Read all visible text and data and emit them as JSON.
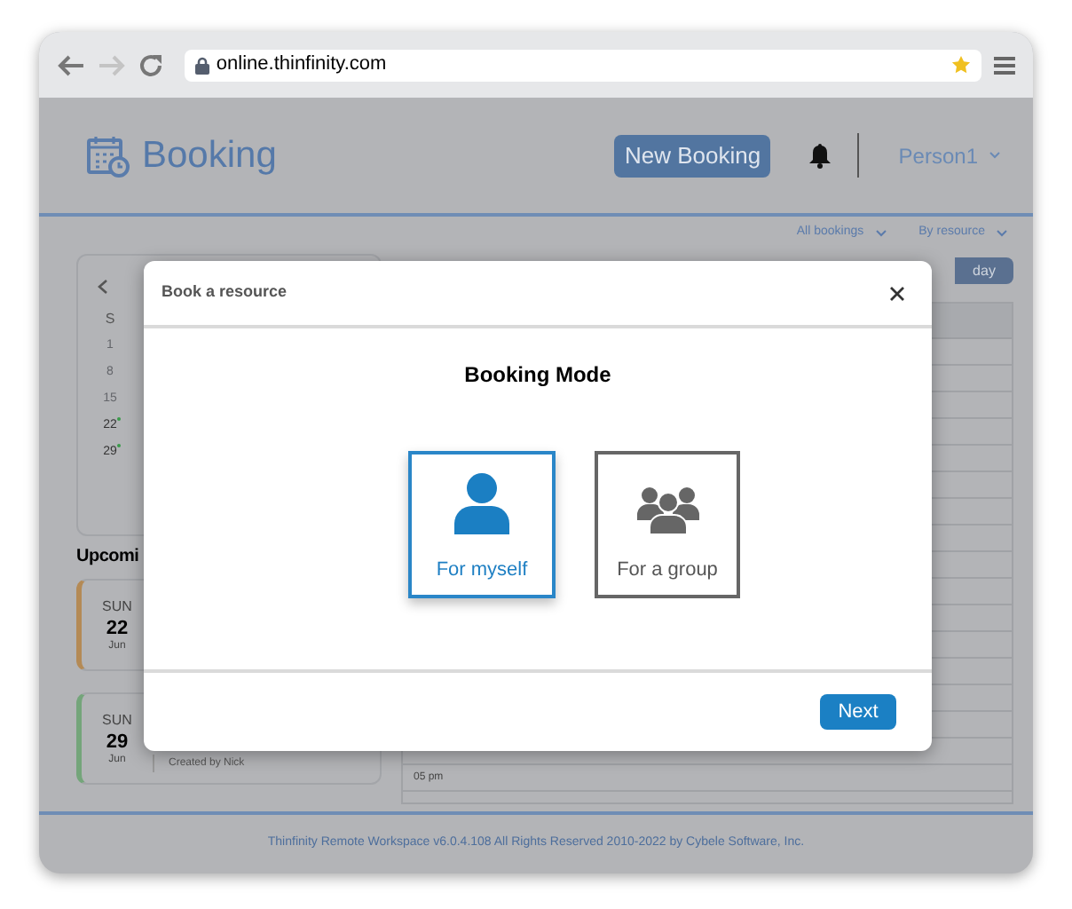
{
  "browser": {
    "url": "online.thinfinity.com"
  },
  "header": {
    "title": "Booking",
    "new_booking": "New Booking",
    "user": "Person1"
  },
  "filters": [
    {
      "label": "All bookings"
    },
    {
      "label": "By resource"
    }
  ],
  "mini_calendar": {
    "weekday": "S",
    "days": [
      {
        "label": "1",
        "has_booking": false
      },
      {
        "label": "8",
        "has_booking": false
      },
      {
        "label": "15",
        "has_booking": false
      },
      {
        "label": "22",
        "has_booking": true
      },
      {
        "label": "29",
        "has_booking": true
      }
    ]
  },
  "upcoming": {
    "heading": "Upcomi",
    "events": [
      {
        "weekday": "SUN",
        "day": "22",
        "month": "Jun",
        "color": "#b48a55"
      },
      {
        "weekday": "SUN",
        "day": "29",
        "month": "Jun",
        "color": "#74a57a",
        "note": "Created by Nick"
      }
    ]
  },
  "calendar": {
    "view_button": "day",
    "time_label": "05 pm"
  },
  "modal": {
    "title": "Book a resource",
    "heading": "Booking Mode",
    "options": [
      {
        "label": "For myself",
        "kind": "single",
        "selected": true
      },
      {
        "label": "For a group",
        "kind": "group",
        "selected": false
      }
    ],
    "next": "Next"
  },
  "footer": "Thinfinity Remote Workspace v6.0.4.108 All Rights Reserved 2010-2022 by Cybele Software, Inc."
}
